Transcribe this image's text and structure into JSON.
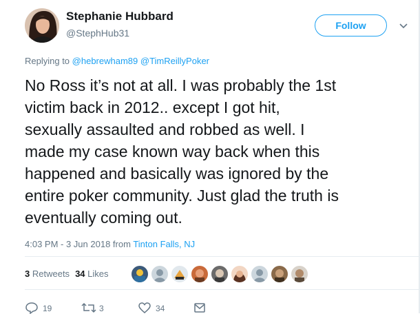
{
  "author": {
    "name": "Stephanie Hubbard",
    "handle": "@StephHub31"
  },
  "follow_label": "Follow",
  "replying": {
    "prefix": "Replying to",
    "mentions": [
      "@hebrewham89",
      "@TimReillyPoker"
    ]
  },
  "tweet": {
    "lines": [
      "No Ross it’s not at all. I was probably the 1st",
      "victim back in 2012.. except I got hit,",
      "sexually assaulted and robbed as well. I",
      "made my case known way back when this",
      "happened and basically was ignored by the",
      "entire poker community. Just glad the truth is",
      "eventually coming out."
    ]
  },
  "meta": {
    "timestamp": "4:03 PM - 3 Jun 2018 from",
    "location": "Tinton Falls, NJ"
  },
  "stats": {
    "retweets_count": "3",
    "retweets_label": "Retweets",
    "likes_count": "34",
    "likes_label": "Likes"
  },
  "actions": {
    "replies": "19",
    "retweets": "3",
    "likes": "34"
  },
  "colors": {
    "accent": "#1da1f2",
    "muted": "#657786",
    "text": "#14171a"
  }
}
